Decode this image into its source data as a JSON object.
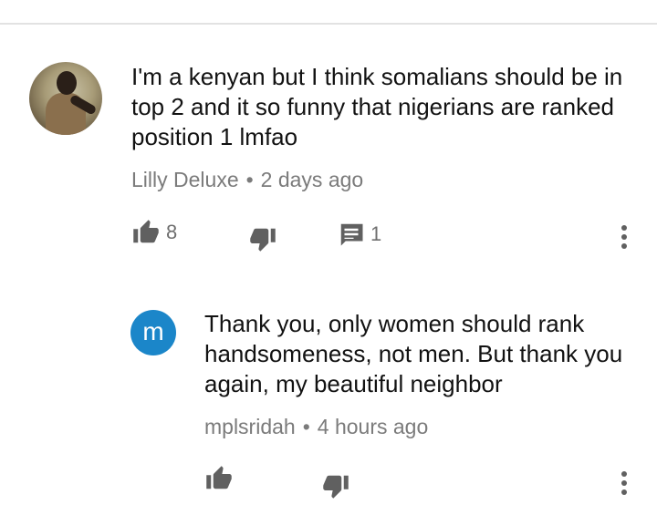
{
  "comments": [
    {
      "text": "I'm a kenyan but I think somalians should be in top 2 and it so funny that nigerians are ranked position 1 lmfao",
      "author": "Lilly Deluxe",
      "separator": "•",
      "time": "2 days ago",
      "likes": "8",
      "replies": "1",
      "avatar": "profile-photo"
    }
  ],
  "reply": {
    "avatar_letter": "m",
    "avatar_color": "#1b86c9",
    "text": "Thank you, only women should rank handsomeness, not men. But thank you again, my beautiful neighbor",
    "author": "mplsridah",
    "separator": "•",
    "time": "4 hours ago"
  },
  "icons": [
    "thumbs-up-icon",
    "thumbs-down-icon",
    "comment-icon",
    "more-vert-icon"
  ],
  "colors": {
    "text": "#121212",
    "meta": "#7b7b7b",
    "icon": "#606060"
  }
}
